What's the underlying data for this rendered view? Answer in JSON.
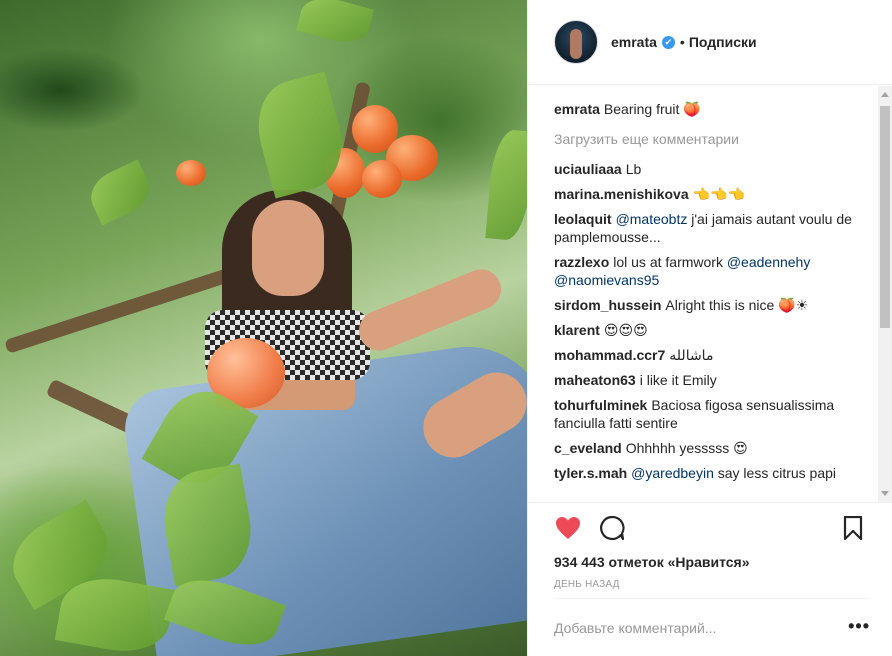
{
  "header": {
    "username": "emrata",
    "verified_mark": "✔",
    "separator": "•",
    "follow_label": "Подписки"
  },
  "caption": {
    "author": "emrata",
    "text": "Bearing fruit 🍑"
  },
  "load_more": "Загрузить еще комментарии",
  "comments": [
    {
      "author": "uciauliaaa",
      "parts": [
        {
          "text": "Lb"
        }
      ]
    },
    {
      "author": "marina.menishikova",
      "parts": [
        {
          "text": "👈👈👈"
        }
      ]
    },
    {
      "author": "leolaquit",
      "parts": [
        {
          "mention": "@mateobtz"
        },
        {
          "text": " j'ai jamais autant voulu de pamplemousse..."
        }
      ]
    },
    {
      "author": "razzlexo",
      "parts": [
        {
          "text": "lol us at farmwork "
        },
        {
          "mention": "@eadennehy"
        },
        {
          "text": " "
        },
        {
          "mention": "@naomievans95"
        }
      ]
    },
    {
      "author": "sirdom_hussein",
      "parts": [
        {
          "text": "Alright this is nice 🍑☀"
        }
      ]
    },
    {
      "author": "klarent",
      "parts": [
        {
          "text": "😍😍😍"
        }
      ]
    },
    {
      "author": "mohammad.ccr7",
      "parts": [
        {
          "text": "ماشالله"
        }
      ]
    },
    {
      "author": "maheaton63",
      "parts": [
        {
          "text": "i like it Emily"
        }
      ]
    },
    {
      "author": "tohurfulminek",
      "parts": [
        {
          "text": "Baciosa figosa sensualissima fanciulla fatti sentire"
        }
      ]
    },
    {
      "author": "c_eveland",
      "parts": [
        {
          "text": "Ohhhhh yesssss 😍"
        }
      ]
    },
    {
      "author": "tyler.s.mah",
      "parts": [
        {
          "mention": "@yaredbeyin"
        },
        {
          "text": " say less citrus papi"
        }
      ]
    }
  ],
  "actions": {
    "like_icon": "heart-icon",
    "comment_icon": "comment-icon",
    "save_icon": "bookmark-icon",
    "like_color": "#ed4956"
  },
  "likes_text": "934 443 отметок «Нравится»",
  "time_text": "ДЕНЬ НАЗАД",
  "add_comment": {
    "placeholder": "Добавьте комментарий...",
    "more": "•••"
  }
}
